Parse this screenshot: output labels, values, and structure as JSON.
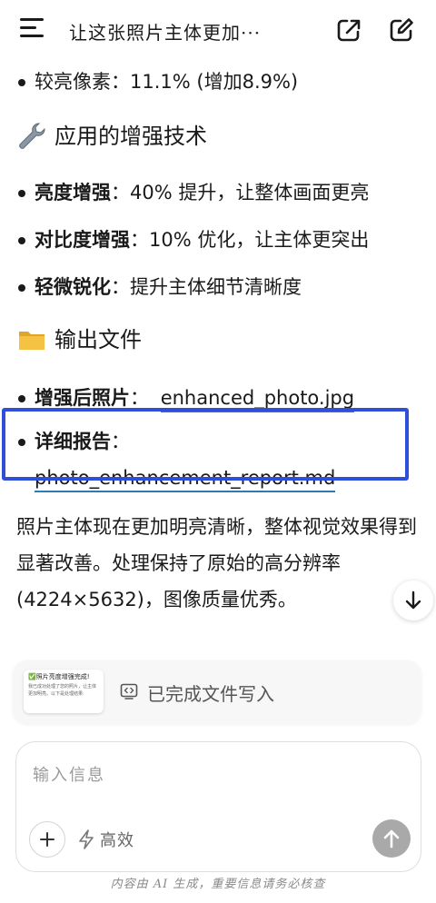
{
  "header": {
    "title": "让这张照片主体更加···",
    "menu_icon": "menu-icon",
    "share_icon": "share-icon",
    "edit_icon": "edit-icon"
  },
  "content": {
    "top_bullet": "较亮像素：11.1% (增加8.9%)",
    "tech_section": {
      "icon": "wrench-icon",
      "title": "应用的增强技术",
      "items": [
        {
          "label": "亮度增强",
          "text": "：40% 提升，让整体画面更亮"
        },
        {
          "label": "对比度增强",
          "text": "：10% 优化，让主体更突出"
        },
        {
          "label": "轻微锐化",
          "text": "：提升主体细节清晰度"
        }
      ]
    },
    "output_section": {
      "icon": "folder-icon",
      "title": "输出文件",
      "files": [
        {
          "label": "增强后照片",
          "sep": "：",
          "link": "enhanced_photo.jpg"
        },
        {
          "label": "详细报告",
          "sep": "：",
          "link": "photo_enhancement_report.md"
        }
      ]
    },
    "summary": "照片主体现在更加明亮清晰，整体视觉效果得到显著改善。处理保持了原始的高分辨率(4224×5632)，图像质量优秀。"
  },
  "status_card": {
    "thumb_title": "✅照片亮度增强完成!",
    "thumb_body": "我已成功处理了您的照片，让主体更加明亮。以下是处理结果:",
    "text": "已完成文件写入"
  },
  "input": {
    "placeholder": "输入信息",
    "mode_label": "高效"
  },
  "footer": "内容由 AI 生成，重要信息请务必核查",
  "colors": {
    "accent_link": "#2b7bb9",
    "highlight": "#2f4fd8",
    "send_button": "#a9a9a9"
  }
}
